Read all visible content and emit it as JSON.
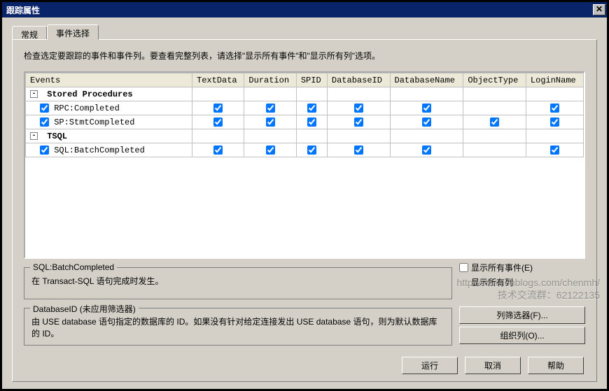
{
  "window": {
    "title": "跟踪属性"
  },
  "tabs": {
    "general": "常规",
    "events": "事件选择"
  },
  "instructions": "检查选定要跟踪的事件和事件列。要查看完整列表，请选择\"显示所有事件\"和\"显示所有列\"选项。",
  "columns": [
    "Events",
    "TextData",
    "Duration",
    "SPID",
    "DatabaseID",
    "DatabaseName",
    "ObjectType",
    "LoginName"
  ],
  "categories": [
    {
      "name": "Stored Procedures",
      "expanded": true,
      "rows": [
        {
          "name": "RPC:Completed",
          "checked": true,
          "cells": [
            true,
            true,
            true,
            true,
            true,
            null,
            true
          ]
        },
        {
          "name": "SP:StmtCompleted",
          "checked": true,
          "cells": [
            true,
            true,
            true,
            true,
            true,
            true,
            true
          ]
        }
      ]
    },
    {
      "name": "TSQL",
      "expanded": true,
      "rows": [
        {
          "name": "SQL:BatchCompleted",
          "checked": true,
          "cells": [
            true,
            true,
            true,
            true,
            true,
            null,
            true
          ]
        }
      ]
    }
  ],
  "info1": {
    "title": "SQL:BatchCompleted",
    "desc": "在 Transact-SQL 语句完成时发生。"
  },
  "info2": {
    "title": "DatabaseID (未应用筛选器)",
    "desc": "由 USE database 语句指定的数据库的 ID。如果没有针对给定连接发出 USE database 语句，则为默认数据库的 ID。"
  },
  "checks": {
    "showAllEvents": "显示所有事件(E)",
    "showAllCols": "显示所有列"
  },
  "buttons": {
    "colFilter": "列筛选器(F)...",
    "orgCols": "组织列(O)...",
    "run": "运行",
    "cancel": "取消",
    "help": "帮助"
  },
  "watermark": {
    "l1": "http://www.cnblogs.com/chenmh/",
    "l2": "技术交流群：62122135"
  }
}
